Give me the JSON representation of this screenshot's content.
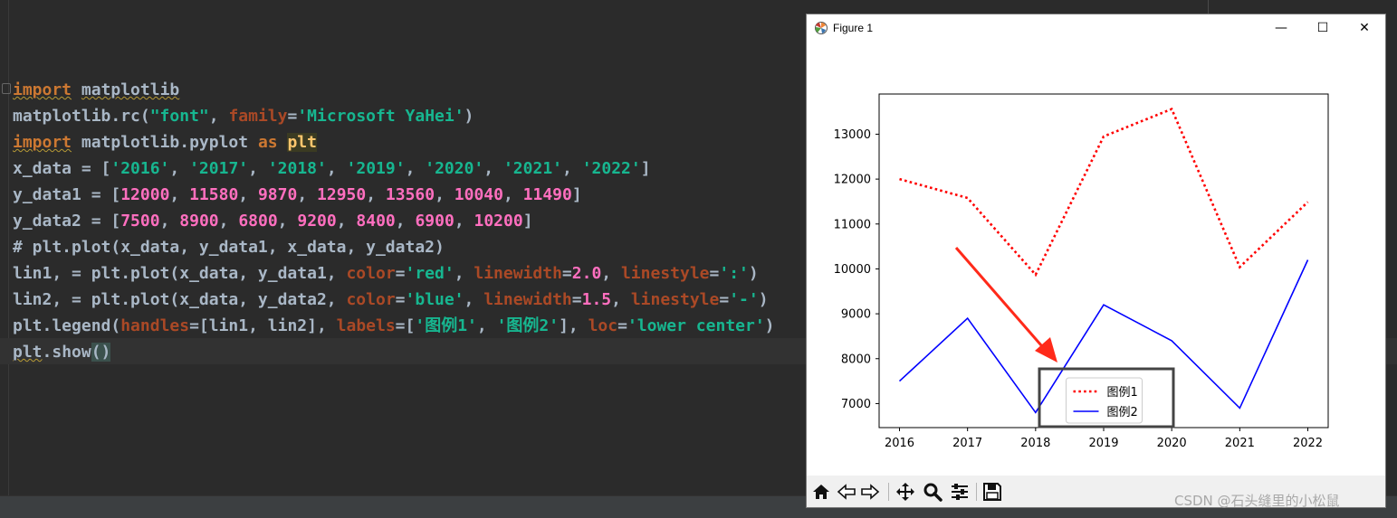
{
  "editor": {
    "lines": [
      [
        {
          "t": "import",
          "c": "kw squig"
        },
        {
          "t": " ",
          "c": ""
        },
        {
          "t": "matplotlib",
          "c": "squig"
        }
      ],
      [
        {
          "t": "matplotlib.rc(",
          "c": ""
        },
        {
          "t": "\"font\"",
          "c": "strg"
        },
        {
          "t": ", ",
          "c": ""
        },
        {
          "t": "family",
          "c": "param"
        },
        {
          "t": "=",
          "c": ""
        },
        {
          "t": "'Microsoft YaHei'",
          "c": "strg"
        },
        {
          "t": ")",
          "c": ""
        }
      ],
      [
        {
          "t": "import",
          "c": "kw squig"
        },
        {
          "t": " matplotlib.pyplot ",
          "c": ""
        },
        {
          "t": "as",
          "c": "kw"
        },
        {
          "t": " ",
          "c": ""
        },
        {
          "t": "plt",
          "c": "hl"
        }
      ],
      [
        {
          "t": "x_data = [",
          "c": ""
        },
        {
          "t": "'2016'",
          "c": "strg"
        },
        {
          "t": ", ",
          "c": ""
        },
        {
          "t": "'2017'",
          "c": "strg"
        },
        {
          "t": ", ",
          "c": ""
        },
        {
          "t": "'2018'",
          "c": "strg"
        },
        {
          "t": ", ",
          "c": ""
        },
        {
          "t": "'2019'",
          "c": "strg"
        },
        {
          "t": ", ",
          "c": ""
        },
        {
          "t": "'2020'",
          "c": "strg"
        },
        {
          "t": ", ",
          "c": ""
        },
        {
          "t": "'2021'",
          "c": "strg"
        },
        {
          "t": ", ",
          "c": ""
        },
        {
          "t": "'2022'",
          "c": "strg"
        },
        {
          "t": "]",
          "c": ""
        }
      ],
      [
        {
          "t": "y_data1 = [",
          "c": ""
        },
        {
          "t": "12000",
          "c": "num"
        },
        {
          "t": ", ",
          "c": ""
        },
        {
          "t": "11580",
          "c": "num"
        },
        {
          "t": ", ",
          "c": ""
        },
        {
          "t": "9870",
          "c": "num"
        },
        {
          "t": ", ",
          "c": ""
        },
        {
          "t": "12950",
          "c": "num"
        },
        {
          "t": ", ",
          "c": ""
        },
        {
          "t": "13560",
          "c": "num"
        },
        {
          "t": ", ",
          "c": ""
        },
        {
          "t": "10040",
          "c": "num"
        },
        {
          "t": ", ",
          "c": ""
        },
        {
          "t": "11490",
          "c": "num"
        },
        {
          "t": "]",
          "c": ""
        }
      ],
      [
        {
          "t": "y_data2 = [",
          "c": ""
        },
        {
          "t": "7500",
          "c": "num"
        },
        {
          "t": ", ",
          "c": ""
        },
        {
          "t": "8900",
          "c": "num"
        },
        {
          "t": ", ",
          "c": ""
        },
        {
          "t": "6800",
          "c": "num"
        },
        {
          "t": ", ",
          "c": ""
        },
        {
          "t": "9200",
          "c": "num"
        },
        {
          "t": ", ",
          "c": ""
        },
        {
          "t": "8400",
          "c": "num"
        },
        {
          "t": ", ",
          "c": ""
        },
        {
          "t": "6900",
          "c": "num"
        },
        {
          "t": ", ",
          "c": ""
        },
        {
          "t": "10200",
          "c": "num"
        },
        {
          "t": "]",
          "c": ""
        }
      ],
      [
        {
          "t": "# plt.plot(x_data, y_data1, x_data, y_data2)",
          "c": ""
        }
      ],
      [
        {
          "t": "lin1, = plt.plot(x_data, y_data1, ",
          "c": ""
        },
        {
          "t": "color",
          "c": "param"
        },
        {
          "t": "=",
          "c": ""
        },
        {
          "t": "'red'",
          "c": "strg"
        },
        {
          "t": ", ",
          "c": ""
        },
        {
          "t": "linewidth",
          "c": "param"
        },
        {
          "t": "=",
          "c": ""
        },
        {
          "t": "2.0",
          "c": "num"
        },
        {
          "t": ", ",
          "c": ""
        },
        {
          "t": "linestyle",
          "c": "param"
        },
        {
          "t": "=",
          "c": ""
        },
        {
          "t": "':'",
          "c": "strg"
        },
        {
          "t": ")",
          "c": ""
        }
      ],
      [
        {
          "t": "lin2, = plt.plot(x_data, y_data2, ",
          "c": ""
        },
        {
          "t": "color",
          "c": "param"
        },
        {
          "t": "=",
          "c": ""
        },
        {
          "t": "'blue'",
          "c": "strg"
        },
        {
          "t": ", ",
          "c": ""
        },
        {
          "t": "linewidth",
          "c": "param"
        },
        {
          "t": "=",
          "c": ""
        },
        {
          "t": "1.5",
          "c": "num"
        },
        {
          "t": ", ",
          "c": ""
        },
        {
          "t": "linestyle",
          "c": "param"
        },
        {
          "t": "=",
          "c": ""
        },
        {
          "t": "'-'",
          "c": "strg"
        },
        {
          "t": ")",
          "c": ""
        }
      ],
      [
        {
          "t": "plt.legend(",
          "c": ""
        },
        {
          "t": "handles",
          "c": "param"
        },
        {
          "t": "=[lin1, lin2], ",
          "c": ""
        },
        {
          "t": "labels",
          "c": "param"
        },
        {
          "t": "=[",
          "c": ""
        },
        {
          "t": "'图例1'",
          "c": "strg"
        },
        {
          "t": ", ",
          "c": ""
        },
        {
          "t": "'图例2'",
          "c": "strg"
        },
        {
          "t": "], ",
          "c": ""
        },
        {
          "t": "loc",
          "c": "param"
        },
        {
          "t": "=",
          "c": ""
        },
        {
          "t": "'lower center'",
          "c": "strg"
        },
        {
          "t": ")",
          "c": ""
        }
      ],
      [
        {
          "t": "plt",
          "c": "squig"
        },
        {
          "t": ".show",
          "c": ""
        },
        {
          "t": "()",
          "c": "paren-hl"
        }
      ]
    ]
  },
  "figure_window": {
    "title": "Figure 1",
    "buttons": {
      "minimize": "—",
      "maximize": "☐",
      "close": "✕"
    },
    "toolbar_icons": [
      "home-icon",
      "back-icon",
      "forward-icon",
      "pan-icon",
      "zoom-icon",
      "configure-icon",
      "save-icon"
    ]
  },
  "chart_data": {
    "type": "line",
    "x": [
      "2016",
      "2017",
      "2018",
      "2019",
      "2020",
      "2021",
      "2022"
    ],
    "series": [
      {
        "name": "图例1",
        "values": [
          12000,
          11580,
          9870,
          12950,
          13560,
          10040,
          11490
        ],
        "color": "#ff0000",
        "linestyle": "dotted"
      },
      {
        "name": "图例2",
        "values": [
          7500,
          8900,
          6800,
          9200,
          8400,
          6900,
          10200
        ],
        "color": "#0000ff",
        "linestyle": "solid"
      }
    ],
    "yticks": [
      7000,
      8000,
      9000,
      10000,
      11000,
      12000,
      13000
    ],
    "ylim": [
      6465,
      13895
    ],
    "legend_loc": "lower center",
    "title": "",
    "xlabel": "",
    "ylabel": ""
  },
  "annotation": {
    "arrow_color": "#ff2a1a",
    "box_color": "#444444"
  },
  "watermark": "CSDN @石头缝里的小松鼠"
}
